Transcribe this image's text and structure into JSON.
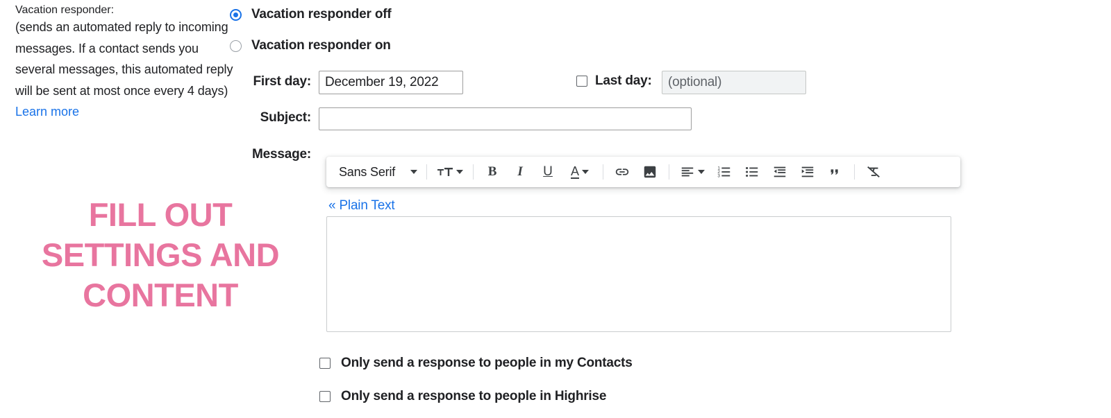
{
  "left_panel": {
    "title": "Vacation responder:",
    "help_text": "(sends an automated reply to incoming messages. If a contact sends you several messages, this automated reply will be sent at most once every 4 days)",
    "learn_more_label": "Learn more"
  },
  "annotation": {
    "text": "FILL OUT SETTINGS AND CONTENT",
    "color": "#e8759f"
  },
  "radios": {
    "off_label": "Vacation responder off",
    "on_label": "Vacation responder on",
    "selected": "off",
    "accent_color": "#1a73e8"
  },
  "fields": {
    "first_day_label": "First day:",
    "first_day_value": "December 19, 2022",
    "last_day_label": "Last day:",
    "last_day_placeholder": "(optional)",
    "last_day_value": "",
    "last_day_checked": false,
    "subject_label": "Subject:",
    "subject_value": "",
    "message_label": "Message:",
    "message_value": ""
  },
  "toolbar": {
    "font_family_label": "Sans Serif",
    "font_family_caret": "chevron-down-icon",
    "font_size_label": "tT",
    "bold_label": "B",
    "italic_label": "I",
    "underline_label": "U",
    "text_color_label": "A",
    "link_label": "link-icon",
    "image_label": "image-icon",
    "align_label": "align-left-icon",
    "numbered_list_label": "numbered-list-icon",
    "bulleted_list_label": "bulleted-list-icon",
    "indent_less_label": "indent-decrease-icon",
    "indent_more_label": "indent-increase-icon",
    "quote_label": "quote-icon",
    "remove_format_label": "remove-formatting-icon"
  },
  "plain_text": {
    "label": "« Plain Text"
  },
  "options": {
    "contacts_label": "Only send a response to people in my Contacts",
    "contacts_checked": false,
    "highrise_label": "Only send a response to people in Highrise",
    "highrise_checked": false
  }
}
